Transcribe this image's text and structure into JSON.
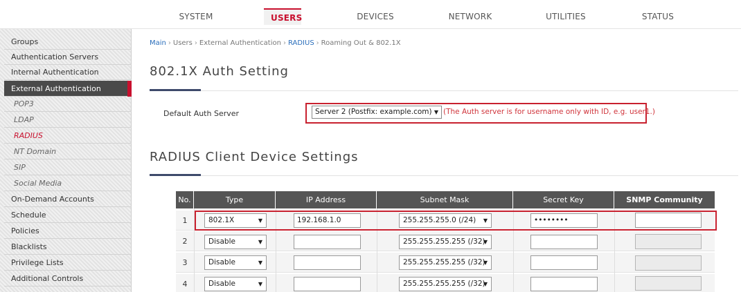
{
  "nav": {
    "items": [
      "SYSTEM",
      "USERS",
      "DEVICES",
      "NETWORK",
      "UTILITIES",
      "STATUS"
    ],
    "active": "USERS"
  },
  "sidebar": {
    "items": [
      {
        "label": "Groups",
        "type": "section"
      },
      {
        "label": "Authentication Servers",
        "type": "section"
      },
      {
        "label": "Internal Authentication",
        "type": "section"
      },
      {
        "label": "External Authentication",
        "type": "section-active"
      },
      {
        "label": "POP3",
        "type": "sub"
      },
      {
        "label": "LDAP",
        "type": "sub"
      },
      {
        "label": "RADIUS",
        "type": "sub-current"
      },
      {
        "label": "NT Domain",
        "type": "sub"
      },
      {
        "label": "SIP",
        "type": "sub"
      },
      {
        "label": "Social Media",
        "type": "sub"
      },
      {
        "label": "On-Demand Accounts",
        "type": "section"
      },
      {
        "label": "Schedule",
        "type": "section"
      },
      {
        "label": "Policies",
        "type": "section"
      },
      {
        "label": "Blacklists",
        "type": "section"
      },
      {
        "label": "Privilege Lists",
        "type": "section"
      },
      {
        "label": "Additional Controls",
        "type": "section"
      }
    ]
  },
  "breadcrumb": {
    "items": [
      "Main",
      "Users",
      "External Authentication",
      "RADIUS",
      "Roaming Out & 802.1X"
    ],
    "separator": "›"
  },
  "auth_setting": {
    "title": "802.1X Auth Setting",
    "label": "Default Auth Server",
    "selected": "Server 2 (Postfix: example.com)",
    "note": "(The Auth server is for username only with ID, e.g. user1.)"
  },
  "client_settings": {
    "title": "RADIUS Client Device Settings",
    "headers": [
      "No.",
      "Type",
      "IP Address",
      "Subnet Mask",
      "Secret Key",
      "SNMP Community"
    ],
    "rows": [
      {
        "no": "1",
        "type": "802.1X",
        "ip": "192.168.1.0",
        "mask": "255.255.255.0 (/24)",
        "secret": "••••••••",
        "snmp": "",
        "enabled": true
      },
      {
        "no": "2",
        "type": "Disable",
        "ip": "",
        "mask": "255.255.255.255 (/32)",
        "secret": "",
        "snmp": "",
        "enabled": false
      },
      {
        "no": "3",
        "type": "Disable",
        "ip": "",
        "mask": "255.255.255.255 (/32)",
        "secret": "",
        "snmp": "",
        "enabled": false
      },
      {
        "no": "4",
        "type": "Disable",
        "ip": "",
        "mask": "255.255.255.255 (/32)",
        "secret": "",
        "snmp": "",
        "enabled": false
      }
    ]
  },
  "colors": {
    "accent": "#c8102e",
    "highlight_box": "#c8202e",
    "note_text": "#d0343b",
    "link": "#2a6ebb",
    "table_header": "#555555",
    "title_underline": "#3e4a6b"
  },
  "icons": {
    "dropdown": "dropdown-arrow-icon"
  }
}
